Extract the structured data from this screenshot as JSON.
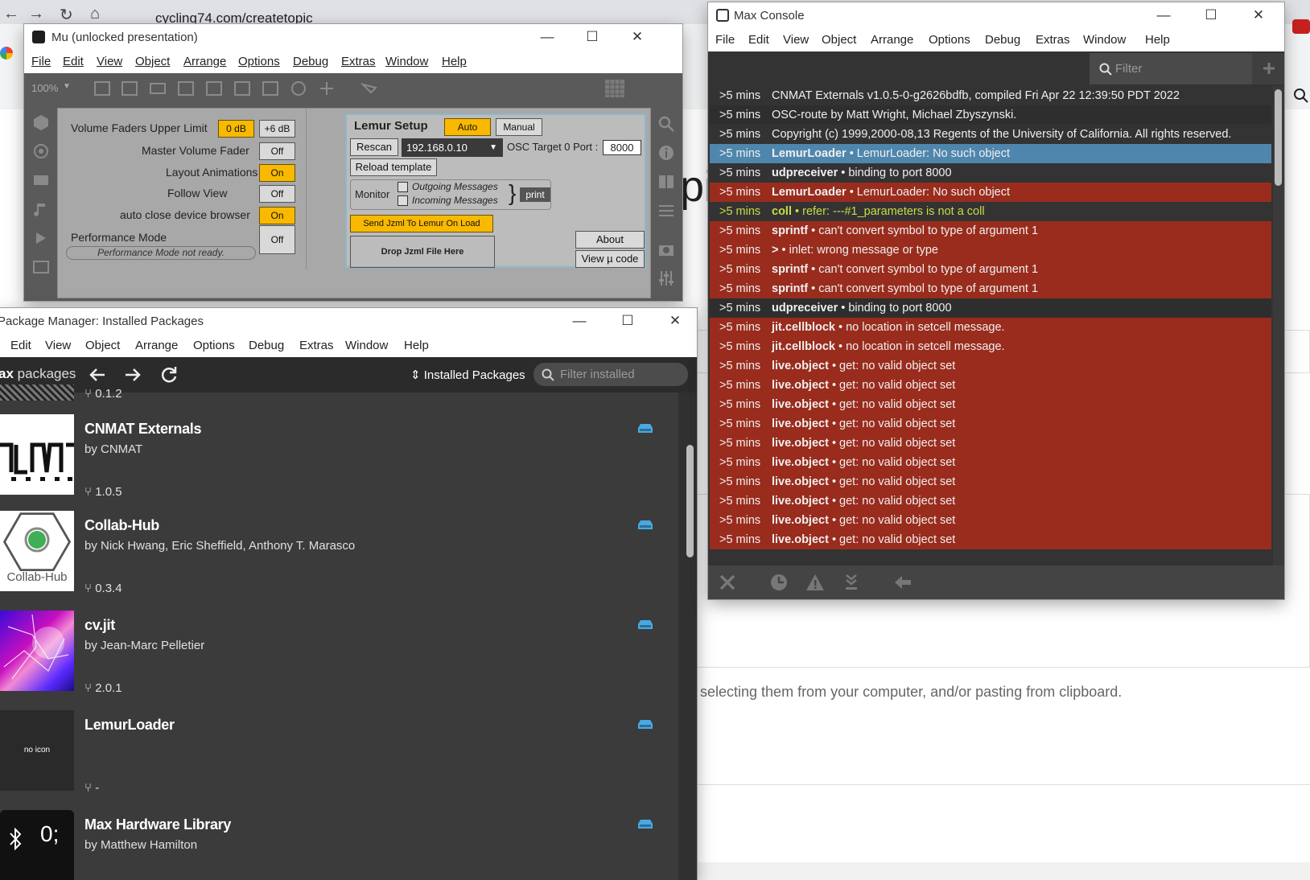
{
  "browser": {
    "url": "cycling74.com/createtopic",
    "page_heading_fragment": "pi",
    "page_hint": ", selecting them from your computer, and/or pasting from clipboard."
  },
  "mu_window": {
    "title": "Mu (unlocked presentation)",
    "menu": [
      "File",
      "Edit",
      "View",
      "Object",
      "Arrange",
      "Options",
      "Debug",
      "Extras",
      "Window",
      "Help"
    ],
    "zoom": "100%",
    "settings": {
      "volume_faders_label": "Volume Faders Upper Limit",
      "volume_faders_opt1": "0 dB",
      "volume_faders_opt2": "+6 dB",
      "master_volume_label": "Master Volume Fader",
      "master_volume_value": "Off",
      "layout_animations_label": "Layout Animations",
      "layout_animations_value": "On",
      "follow_view_label": "Follow View",
      "follow_view_value": "Off",
      "auto_close_label": "auto close device browser",
      "auto_close_value": "On",
      "performance_mode_label": "Performance Mode",
      "performance_mode_status": "Performance Mode not ready.",
      "performance_mode_value": "Off"
    },
    "lemur": {
      "title": "Lemur Setup",
      "auto": "Auto",
      "manual": "Manual",
      "rescan": "Rescan",
      "ip": "192.168.0.10",
      "osc_target_label": "OSC Target 0 Port :",
      "osc_port": "8000",
      "reload": "Reload template",
      "monitor": "Monitor",
      "outgoing": "Outgoing Messages",
      "incoming": "Incoming Messages",
      "print": "print",
      "send_jzml": "Send Jzml To Lemur On Load",
      "drop_jzml": "Drop Jzml File Here",
      "about": "About",
      "view_code": "View µ code"
    }
  },
  "package_manager": {
    "title": "Package Manager: Installed Packages",
    "menu": [
      "Edit",
      "View",
      "Object",
      "Arrange",
      "Options",
      "Debug",
      "Extras",
      "Window",
      "Help"
    ],
    "brand_bold": "ax",
    "brand_light": "packages",
    "view_select": "Installed Packages",
    "filter_placeholder": "Filter installed",
    "partial_version": "0.1.2",
    "packages": [
      {
        "name": "CNMAT Externals",
        "author": "by CNMAT",
        "version": "1.0.5"
      },
      {
        "name": "Collab-Hub",
        "author": "by Nick Hwang, Eric Sheffield, Anthony T. Marasco",
        "version": "0.3.4",
        "icon_text": "Collab-Hub"
      },
      {
        "name": "cv.jit",
        "author": "by Jean-Marc Pelletier",
        "version": "2.0.1"
      },
      {
        "name": "LemurLoader",
        "author": "",
        "version": "-",
        "icon_text": "no icon"
      },
      {
        "name": "Max Hardware Library",
        "author": "by Matthew Hamilton",
        "version": "",
        "icon_text": "0;"
      }
    ]
  },
  "console": {
    "title": "Max Console",
    "menu": [
      "File",
      "Edit",
      "View",
      "Object",
      "Arrange",
      "Options",
      "Debug",
      "Extras",
      "Window",
      "Help"
    ],
    "filter_placeholder": "Filter",
    "colors": {
      "error": "#992c1d",
      "selected": "#4f86ad",
      "normal": "#333333",
      "warning_text": "#c9dc45"
    },
    "rows": [
      {
        "time": ">5 mins",
        "source": "",
        "message": "CNMAT Externals v1.0.5-0-g2626bdfb, compiled Fri Apr 22 12:39:50 PDT 2022",
        "kind": "normal"
      },
      {
        "time": ">5 mins",
        "source": "",
        "message": "OSC-route by Matt Wright, Michael Zbyszynski.",
        "kind": "normal"
      },
      {
        "time": ">5 mins",
        "source": "",
        "message": "Copyright (c) 1999,2000-08,13 Regents of the University of California.  All rights reserved.",
        "kind": "normal"
      },
      {
        "time": ">5 mins",
        "source": "LemurLoader",
        "message": " • LemurLoader: No such object",
        "kind": "selected"
      },
      {
        "time": ">5 mins",
        "source": "udpreceiver",
        "message": " • binding to port 8000",
        "kind": "normal"
      },
      {
        "time": ">5 mins",
        "source": "LemurLoader",
        "message": " • LemurLoader: No such object",
        "kind": "error"
      },
      {
        "time": ">5 mins",
        "source": "coll",
        "message": " • refer: ---#1_parameters is not a coll",
        "kind": "warning"
      },
      {
        "time": ">5 mins",
        "source": "sprintf",
        "message": " • can't convert symbol to type of argument 1",
        "kind": "error"
      },
      {
        "time": ">5 mins",
        "source": ">",
        "message": " • inlet: wrong message or type",
        "kind": "error"
      },
      {
        "time": ">5 mins",
        "source": "sprintf",
        "message": " • can't convert symbol to type of argument 1",
        "kind": "error"
      },
      {
        "time": ">5 mins",
        "source": "sprintf",
        "message": " • can't convert symbol to type of argument 1",
        "kind": "error"
      },
      {
        "time": ">5 mins",
        "source": "udpreceiver",
        "message": " • binding to port 8000",
        "kind": "normal"
      },
      {
        "time": ">5 mins",
        "source": "jit.cellblock",
        "message": " • no location in setcell message.",
        "kind": "error"
      },
      {
        "time": ">5 mins",
        "source": "jit.cellblock",
        "message": " • no location in setcell message.",
        "kind": "error"
      },
      {
        "time": ">5 mins",
        "source": "live.object",
        "message": " • get: no valid object set",
        "kind": "error"
      },
      {
        "time": ">5 mins",
        "source": "live.object",
        "message": " • get: no valid object set",
        "kind": "error"
      },
      {
        "time": ">5 mins",
        "source": "live.object",
        "message": " • get: no valid object set",
        "kind": "error"
      },
      {
        "time": ">5 mins",
        "source": "live.object",
        "message": " • get: no valid object set",
        "kind": "error"
      },
      {
        "time": ">5 mins",
        "source": "live.object",
        "message": " • get: no valid object set",
        "kind": "error"
      },
      {
        "time": ">5 mins",
        "source": "live.object",
        "message": " • get: no valid object set",
        "kind": "error"
      },
      {
        "time": ">5 mins",
        "source": "live.object",
        "message": " • get: no valid object set",
        "kind": "error"
      },
      {
        "time": ">5 mins",
        "source": "live.object",
        "message": " • get: no valid object set",
        "kind": "error"
      },
      {
        "time": ">5 mins",
        "source": "live.object",
        "message": " • get: no valid object set",
        "kind": "error"
      },
      {
        "time": ">5 mins",
        "source": "live.object",
        "message": " • get: no valid object set",
        "kind": "error"
      }
    ]
  }
}
